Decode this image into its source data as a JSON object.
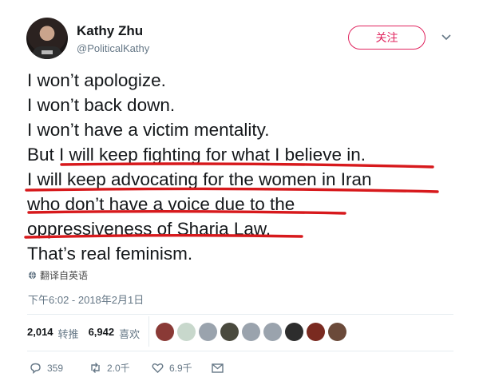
{
  "author": {
    "name": "Kathy Zhu",
    "handle": "@PoliticalKathy"
  },
  "follow_label": "关注",
  "tweet_lines": [
    "I won’t apologize.",
    "I won’t back down.",
    "I won’t have a victim mentality.",
    "But I will keep fighting for what I believe in.",
    "I will keep advocating for the women in Iran",
    "who don’t have a voice due to the",
    "oppressiveness of Sharia Law.",
    "That’s real feminism."
  ],
  "translate_label": "翻译自英语",
  "timestamp": "下午6:02 - 2018年2月1日",
  "stats": {
    "retweets_count": "2,014",
    "retweets_label": "转推",
    "likes_count": "6,942",
    "likes_label": "喜欢"
  },
  "liker_avatar_colors": [
    "#8a3a36",
    "#c8d8cc",
    "#9aa3ad",
    "#4a4a3e",
    "#9aa3ad",
    "#9aa3ad",
    "#2d2d2d",
    "#7a2a20",
    "#6b4a3a"
  ],
  "actions": {
    "replies": "359",
    "retweets": "2.0千",
    "likes": "6.9千"
  },
  "colors": {
    "follow_accent": "#e0245e",
    "underline_red": "#d7191c",
    "secondary_text": "#657786"
  }
}
